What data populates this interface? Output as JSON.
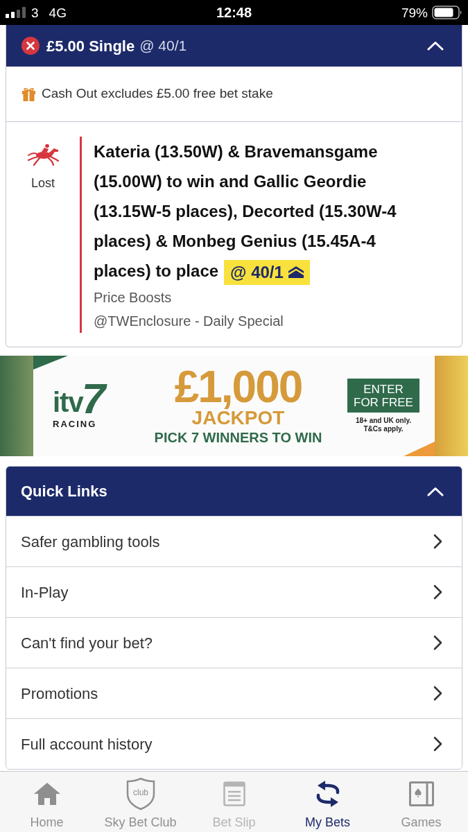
{
  "status_bar": {
    "carrier": "3",
    "network": "4G",
    "time": "12:48",
    "battery": "79%"
  },
  "bet": {
    "lost": true,
    "title": "£5.00 Single",
    "odds": "@ 40/1",
    "expanded": true,
    "notice": "Cash Out excludes £5.00 free bet stake",
    "status": "Lost",
    "selection": "Kateria (13.50W) & Bravemansgame (15.00W) to win and Gallic Geordie (13.15W-5 places), Decorted (15.30W-4 places) & Monbeg Genius (15.45A-4 places) to place",
    "price": "@ 40/1",
    "boosted": true,
    "market": "Price Boosts",
    "event": "@TWEnclosure - Daily Special"
  },
  "banner": {
    "logo": {
      "wordmark": "itv",
      "digit": "7",
      "caption": "RACING"
    },
    "amount": "£1,000",
    "headline": "JACKPOT",
    "tagline": "PICK 7 WINNERS TO WIN",
    "button": "ENTER FOR FREE",
    "terms": "18+ and UK only. T&Cs apply."
  },
  "quick_links": {
    "title": "Quick Links",
    "expanded": true,
    "items": [
      {
        "label": "Safer gambling tools"
      },
      {
        "label": "In-Play"
      },
      {
        "label": "Can't find your bet?"
      },
      {
        "label": "Promotions"
      },
      {
        "label": "Full account history"
      }
    ]
  },
  "tab_bar": {
    "tabs": [
      {
        "kind": "home",
        "label": "Home",
        "selected": false,
        "disabled": false
      },
      {
        "kind": "club",
        "label": "Sky Bet Club",
        "badge": "club",
        "selected": false,
        "disabled": false
      },
      {
        "kind": "slip",
        "label": "Bet Slip",
        "selected": false,
        "disabled": true
      },
      {
        "kind": "bets",
        "label": "My Bets",
        "selected": true,
        "disabled": false
      },
      {
        "kind": "games",
        "label": "Games",
        "selected": false,
        "disabled": false
      }
    ]
  }
}
